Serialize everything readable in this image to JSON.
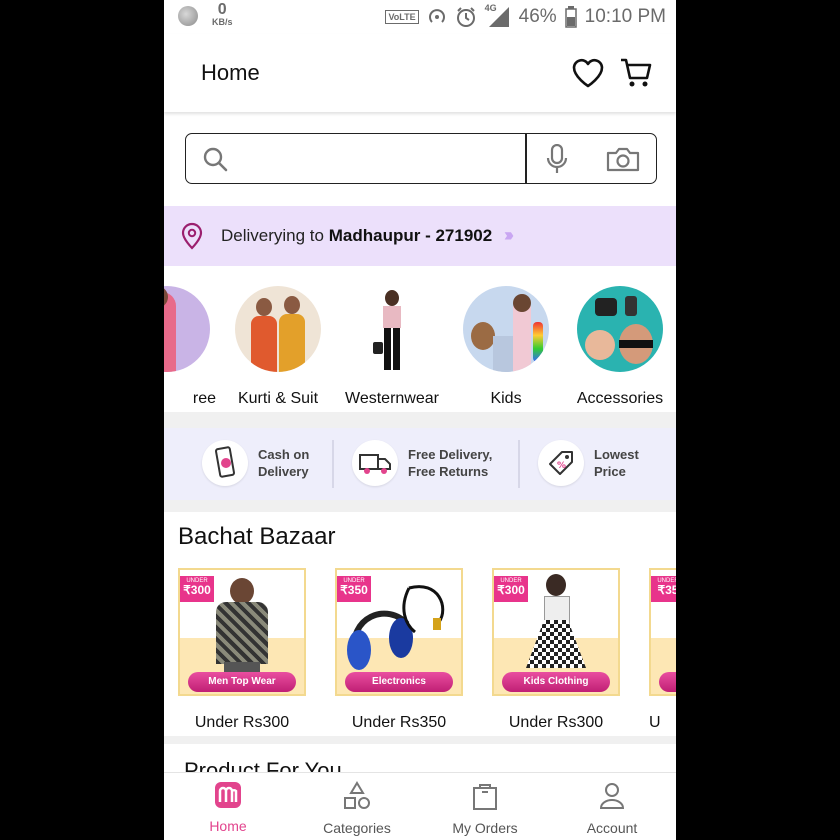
{
  "status_bar": {
    "net_speed_value": "0",
    "net_speed_unit": "KB/s",
    "volte": "VoLTE",
    "network": "4G",
    "battery": "46%",
    "time": "10:10 PM"
  },
  "header": {
    "title": "Home"
  },
  "search": {
    "placeholder": ""
  },
  "delivery": {
    "prefix": "Deliverying to",
    "location": "Madhaupur - 271902"
  },
  "categories": [
    {
      "label": "ree"
    },
    {
      "label": "Kurti & Suit"
    },
    {
      "label": "Westernwear"
    },
    {
      "label": "Kids"
    },
    {
      "label": "Accessories"
    }
  ],
  "trust": [
    {
      "line1": "Cash on",
      "line2": "Delivery"
    },
    {
      "line1": "Free Delivery,",
      "line2": "Free Returns"
    },
    {
      "line1": "Lowest",
      "line2": "Price"
    }
  ],
  "bachat": {
    "title": "Bachat Bazaar",
    "deals": [
      {
        "tag_small": "UNDER",
        "tag_price": "₹300",
        "pill": "Men Top Wear",
        "label": "Under Rs300"
      },
      {
        "tag_small": "UNDER",
        "tag_price": "₹350",
        "pill": "Electronics",
        "label": "Under Rs350"
      },
      {
        "tag_small": "UNDER",
        "tag_price": "₹300",
        "pill": "Kids Clothing",
        "label": "Under Rs300"
      },
      {
        "tag_small": "UNDER",
        "tag_price": "₹35",
        "pill": "",
        "label": "U"
      }
    ]
  },
  "next_section": {
    "title": "Product For You"
  },
  "bottom_nav": [
    {
      "label": "Home",
      "icon": "meesho-logo-icon",
      "active": true
    },
    {
      "label": "Categories",
      "icon": "categories-icon"
    },
    {
      "label": "My Orders",
      "icon": "orders-bag-icon"
    },
    {
      "label": "Account",
      "icon": "account-icon"
    }
  ],
  "colors": {
    "accent": "#e2448d",
    "delivery_bg": "#ece0fb",
    "trust_bg": "#eeeefb",
    "tag_pink": "#e8348b"
  }
}
